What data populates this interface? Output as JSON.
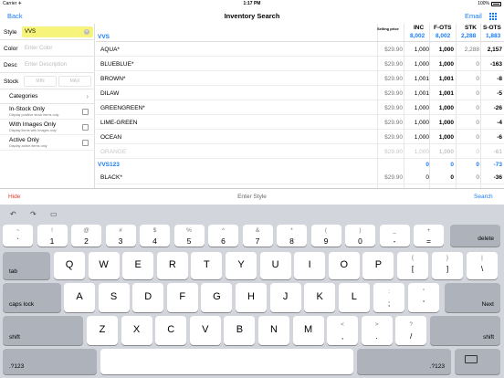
{
  "status_bar": {
    "carrier": "Carrier ✈",
    "time": "1:17 PM",
    "battery": "100%"
  },
  "nav": {
    "back": "Back",
    "title": "Inventory Search",
    "email": "Email",
    "grid_icon": "grid-icon"
  },
  "filters": {
    "style_label": "Style",
    "style_value": "VVS",
    "color_label": "Color",
    "color_placeholder": "Enter Color",
    "desc_label": "Desc",
    "desc_placeholder": "Enter Description",
    "stock_label": "Stock",
    "min_placeholder": "MIN",
    "max_placeholder": "MAX",
    "categories_label": "Categories",
    "in_stock": {
      "title": "In-Stock Only",
      "sub": "Display positive stock items only"
    },
    "with_images": {
      "title": "With Images Only",
      "sub": "Display items with images only"
    },
    "active": {
      "title": "Active Only",
      "sub": "Display active items only"
    }
  },
  "table": {
    "headers": {
      "price": "Selling price",
      "inc": "INC",
      "fots": "F-OTS",
      "stk": "STK",
      "sots": "S-OTS"
    },
    "groups": [
      {
        "name": "VVS",
        "totals": {
          "inc": "8,002",
          "fots": "8,002",
          "stk": "2,288",
          "sots": "1,883"
        },
        "rows": [
          {
            "name": "AQUA*",
            "price": "$29.90",
            "inc": "1,000",
            "fots": "1,000",
            "stk": "2,288",
            "sots": "2,157",
            "dim": false
          },
          {
            "name": "BLUEBLUE*",
            "price": "$29.90",
            "inc": "1,000",
            "fots": "1,000",
            "stk": "0",
            "sots": "-163",
            "dim": false
          },
          {
            "name": "BROWN*",
            "price": "$29.90",
            "inc": "1,001",
            "fots": "1,001",
            "stk": "0",
            "sots": "-8",
            "dim": false
          },
          {
            "name": "DILAW",
            "price": "$29.90",
            "inc": "1,001",
            "fots": "1,001",
            "stk": "0",
            "sots": "-5",
            "dim": false
          },
          {
            "name": "GREENGREEN*",
            "price": "$29.90",
            "inc": "1,000",
            "fots": "1,000",
            "stk": "0",
            "sots": "-26",
            "dim": false
          },
          {
            "name": "LIME-GREEN",
            "price": "$29.90",
            "inc": "1,000",
            "fots": "1,000",
            "stk": "0",
            "sots": "-4",
            "dim": false
          },
          {
            "name": "OCEAN",
            "price": "$29.90",
            "inc": "1,000",
            "fots": "1,000",
            "stk": "0",
            "sots": "-6",
            "dim": false
          },
          {
            "name": "ORANGE",
            "price": "$29.90",
            "inc": "1,000",
            "fots": "1,000",
            "stk": "0",
            "sots": "-61",
            "dim": true
          }
        ]
      },
      {
        "name": "VVS123",
        "totals": {
          "inc": "0",
          "fots": "0",
          "stk": "0",
          "sots": "-73"
        },
        "rows": [
          {
            "name": "BLACK*",
            "price": "$29.90",
            "inc": "0",
            "fots": "0",
            "stk": "0",
            "sots": "-36",
            "dim": false
          }
        ]
      }
    ]
  },
  "accessory": {
    "hide": "Hide",
    "placeholder": "Enter Style",
    "search": "Search"
  },
  "keyboard": {
    "toolbar_icons": [
      "undo-icon",
      "redo-icon",
      "paste-icon"
    ],
    "row1": [
      {
        "top": "~",
        "bot": "`"
      },
      {
        "top": "!",
        "bot": "1"
      },
      {
        "top": "@",
        "bot": "2"
      },
      {
        "top": "#",
        "bot": "3"
      },
      {
        "top": "$",
        "bot": "4"
      },
      {
        "top": "%",
        "bot": "5"
      },
      {
        "top": "^",
        "bot": "6"
      },
      {
        "top": "&",
        "bot": "7"
      },
      {
        "top": "*",
        "bot": "8"
      },
      {
        "top": "(",
        "bot": "9"
      },
      {
        "top": ")",
        "bot": "0"
      },
      {
        "top": "_",
        "bot": "-"
      },
      {
        "top": "+",
        "bot": "="
      }
    ],
    "delete": "delete",
    "tab": "tab",
    "row2": [
      "Q",
      "W",
      "E",
      "R",
      "T",
      "Y",
      "U",
      "I",
      "O",
      "P"
    ],
    "row2_sym": [
      {
        "top": "{",
        "bot": "["
      },
      {
        "top": "}",
        "bot": "]"
      },
      {
        "top": "|",
        "bot": "\\"
      }
    ],
    "caps": "caps lock",
    "row3": [
      "A",
      "S",
      "D",
      "F",
      "G",
      "H",
      "J",
      "K",
      "L"
    ],
    "row3_sym": [
      {
        "top": ":",
        "bot": ";"
      },
      {
        "top": "\"",
        "bot": "'"
      }
    ],
    "next": "Next",
    "shift": "shift",
    "row4": [
      "Z",
      "X",
      "C",
      "V",
      "B",
      "N",
      "M"
    ],
    "row4_sym": [
      {
        "top": "<",
        "bot": ","
      },
      {
        "top": ">",
        "bot": "."
      },
      {
        "top": "?",
        "bot": "/"
      }
    ],
    "num": ".?123",
    "dismiss_icon": "keyboard-dismiss-icon"
  },
  "colors": {
    "accent": "#1a7cf5",
    "hide": "#e03a2b",
    "style_highlight": "#f6f47a",
    "keyboard_bg": "#d2d5db"
  }
}
